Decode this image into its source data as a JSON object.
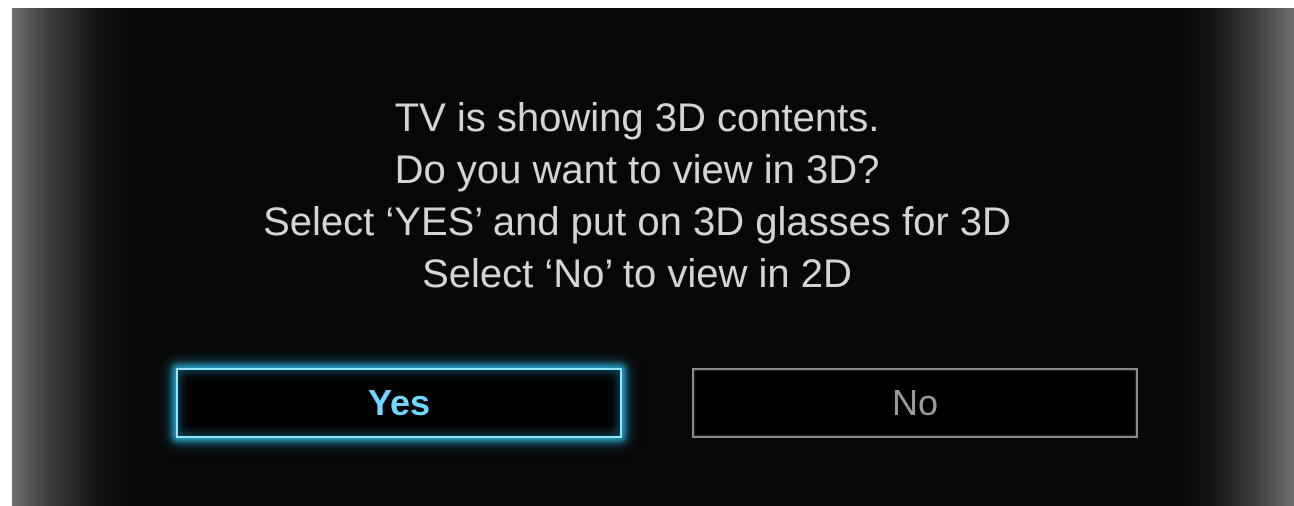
{
  "dialog": {
    "message_lines": [
      "TV is showing 3D contents.",
      "Do you want to view in 3D?",
      "Select ‘YES’ and put on 3D glasses for 3D",
      "Select ‘No’ to view in 2D"
    ],
    "buttons": {
      "yes_label": "Yes",
      "no_label": "No",
      "focused": "yes"
    }
  },
  "colors": {
    "background": "#070707",
    "text": "#d4d4d4",
    "focus_glow": "#2aa3c8",
    "focused_label": "#6fd6ff",
    "unfocused_label": "#9a9a9a"
  }
}
